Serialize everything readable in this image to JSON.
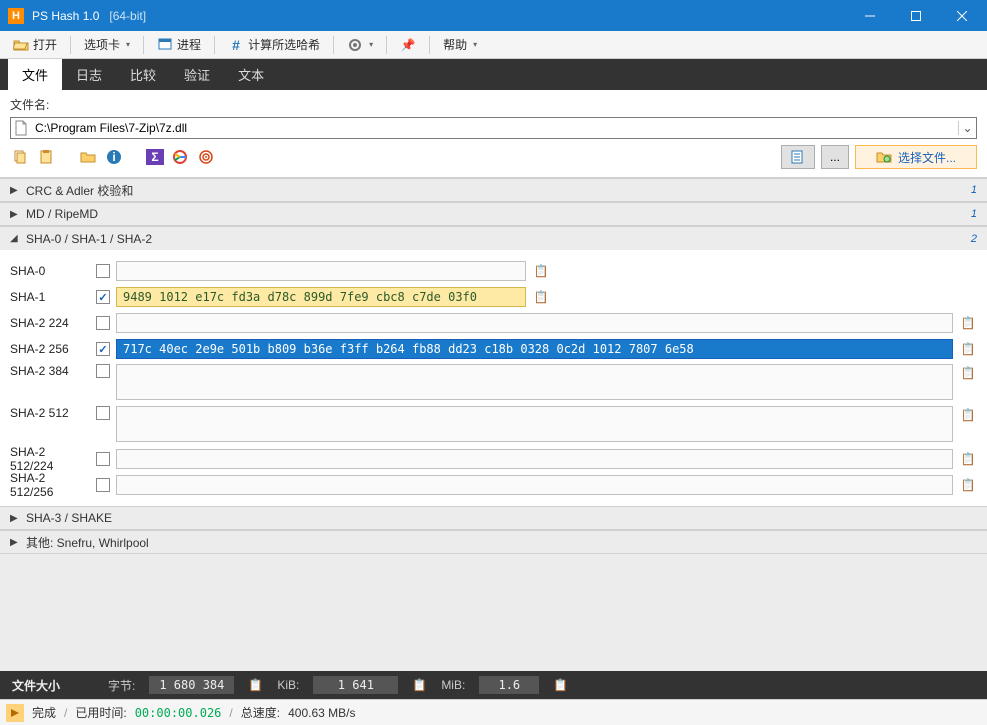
{
  "window": {
    "title": "PS Hash 1.0",
    "suffix": "[64-bit]"
  },
  "toolbar": {
    "open": "打开",
    "tabs": "选项卡",
    "process": "进程",
    "compute": "计算所选哈希",
    "help": "帮助"
  },
  "tabs": [
    "文件",
    "日志",
    "比较",
    "验证",
    "文本"
  ],
  "file": {
    "label": "文件名:",
    "path": "C:\\Program Files\\7-Zip\\7z.dll",
    "select_btn": "选择文件..."
  },
  "sections": {
    "crc": {
      "title": "CRC & Adler 校验和",
      "count": "1"
    },
    "md": {
      "title": "MD / RipeMD",
      "count": "1"
    },
    "sha": {
      "title": "SHA-0 / SHA-1 / SHA-2",
      "count": "2"
    },
    "sha3": {
      "title": "SHA-3 / SHAKE"
    },
    "other": {
      "title": "其他: Snefru, Whirlpool"
    }
  },
  "hashes": {
    "sha0": {
      "label": "SHA-0",
      "checked": false,
      "value": ""
    },
    "sha1": {
      "label": "SHA-1",
      "checked": true,
      "value": "9489 1012 e17c fd3a d78c 899d 7fe9 cbc8 c7de 03f0"
    },
    "sha2_224": {
      "label": "SHA-2 224",
      "checked": false,
      "value": ""
    },
    "sha2_256": {
      "label": "SHA-2 256",
      "checked": true,
      "value": "717c 40ec 2e9e 501b b809 b36e f3ff b264 fb88 dd23 c18b 0328 0c2d 1012 7807 6e58"
    },
    "sha2_384": {
      "label": "SHA-2 384",
      "checked": false,
      "value": ""
    },
    "sha2_512": {
      "label": "SHA-2 512",
      "checked": false,
      "value": ""
    },
    "sha2_512_224": {
      "label": "SHA-2 512/224",
      "checked": false,
      "value": ""
    },
    "sha2_512_256": {
      "label": "SHA-2 512/256",
      "checked": false,
      "value": ""
    }
  },
  "size": {
    "title": "文件大小",
    "bytes_label": "字节:",
    "bytes": "1 680 384",
    "kib_label": "KiB:",
    "kib": "1 641",
    "mib_label": "MiB:",
    "mib": "1.6"
  },
  "status": {
    "done": "完成",
    "elapsed_label": "已用时间:",
    "elapsed": "00:00:00.026",
    "speed_label": "总速度:",
    "speed": "400.63 MB/s"
  }
}
